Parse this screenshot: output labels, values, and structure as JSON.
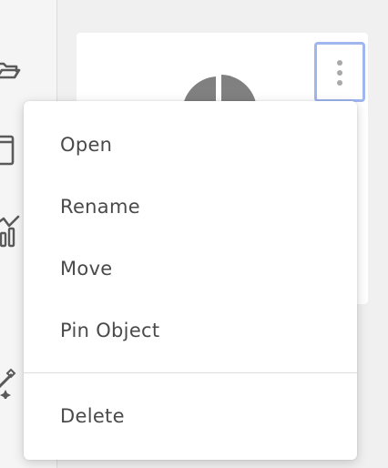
{
  "sidebar": {
    "icons": [
      "folder-open-icon",
      "window-icon",
      "chart-icon",
      "magic-wand-icon"
    ]
  },
  "card": {
    "thumbnail_icon": "pie-chart-icon",
    "more_icon": "kebab-menu-icon",
    "thumbnail_color": "#808080"
  },
  "context_menu": {
    "items": [
      {
        "label": "Open"
      },
      {
        "label": "Rename"
      },
      {
        "label": "Move"
      },
      {
        "label": "Pin Object"
      },
      {
        "label": "Delete"
      }
    ]
  },
  "colors": {
    "focus_ring": "#9fb6ef",
    "menu_text": "#4a4a4a",
    "icon_gray": "#5a5a5a"
  }
}
